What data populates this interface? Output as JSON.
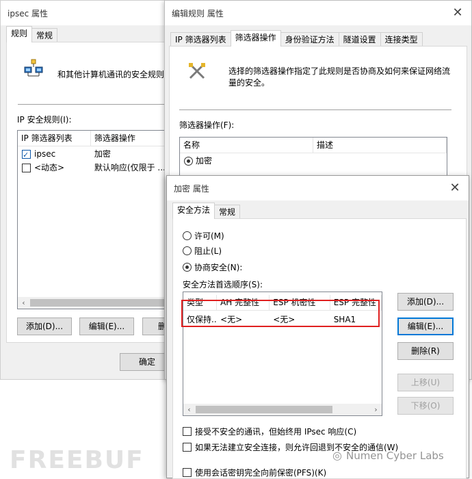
{
  "win1": {
    "title": "ipsec 属性",
    "tabs": [
      "规则",
      "常规"
    ],
    "description": "和其他计算机通讯的安全规则",
    "rules_label": "IP 安全规则(I):",
    "columns": [
      "IP 筛选器列表",
      "筛选器操作"
    ],
    "rows": [
      {
        "checked": true,
        "name": "ipsec",
        "action": "加密"
      },
      {
        "checked": false,
        "name": "<动态>",
        "action": "默认响应(仅限于 ..."
      }
    ],
    "buttons": {
      "add": "添加(D)...",
      "edit": "编辑(E)...",
      "remove": "删",
      "ok": "确定"
    }
  },
  "win2": {
    "title": "编辑规则 属性",
    "tabs": [
      "IP 筛选器列表",
      "筛选器操作",
      "身份验证方法",
      "隧道设置",
      "连接类型"
    ],
    "description": "选择的筛选器操作指定了此规则是否协商及如何来保证网络流量的安全。",
    "actions_label": "筛选器操作(F):",
    "columns": [
      "名称",
      "描述"
    ],
    "rows": [
      {
        "name": "加密",
        "selected": true
      }
    ]
  },
  "win3": {
    "title": "加密 属性",
    "tabs": [
      "安全方法",
      "常规"
    ],
    "radios": {
      "permit": "许可(M)",
      "block": "阻止(L)",
      "negotiate": "协商安全(N):"
    },
    "order_label": "安全方法首选顺序(S):",
    "columns": [
      "类型",
      "AH 完整性",
      "ESP 机密性",
      "ESP 完整性"
    ],
    "rows": [
      {
        "type": "仅保持...",
        "ah": "<无>",
        "esp_conf": "<无>",
        "esp_int": "SHA1"
      }
    ],
    "buttons": {
      "add": "添加(D)...",
      "edit": "编辑(E)...",
      "remove": "删除(R)",
      "up": "上移(U)",
      "down": "下移(O)"
    },
    "checks": {
      "accept_unsecured": "接受不安全的通讯，但始终用 IPsec 响应(C)",
      "fallback": "如果无法建立安全连接，则允许回退到不安全的通信(W)",
      "pfs": "使用会话密钥完全向前保密(PFS)(K)"
    }
  },
  "watermarks": {
    "left": "FREEBUF",
    "right": "Numen Cyber Labs"
  },
  "colors": {
    "highlight_box": "#e02020",
    "default_button_border": "#0078d7"
  }
}
